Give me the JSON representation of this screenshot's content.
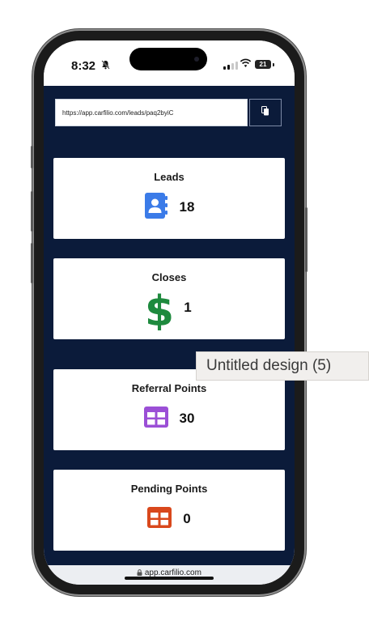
{
  "status_bar": {
    "time": "8:32",
    "battery": "21",
    "icons": [
      "bell-slash-icon",
      "signal-icon",
      "wifi-icon",
      "battery-icon"
    ]
  },
  "referral": {
    "url_value": "https://app.carfilio.com/leads/paq2byiC",
    "copy_icon": "copy-icon"
  },
  "cards": [
    {
      "title": "Leads",
      "value": "18",
      "icon": "contact-book-icon",
      "color": "#3b7be8"
    },
    {
      "title": "Closes",
      "value": "1",
      "icon": "dollar-icon",
      "color": "#1e8a3e"
    },
    {
      "title": "Referral Points",
      "value": "30",
      "icon": "table-icon",
      "color": "#9b4fd6"
    },
    {
      "title": "Pending Points",
      "value": "0",
      "icon": "table-icon",
      "color": "#d9481c"
    }
  ],
  "browser": {
    "domain": "app.carfilio.com",
    "lock_icon": "lock-icon"
  },
  "tooltip": {
    "text": "Untitled design (5)"
  },
  "colors": {
    "app_background": "#0b1b3a",
    "card_background": "#ffffff"
  }
}
